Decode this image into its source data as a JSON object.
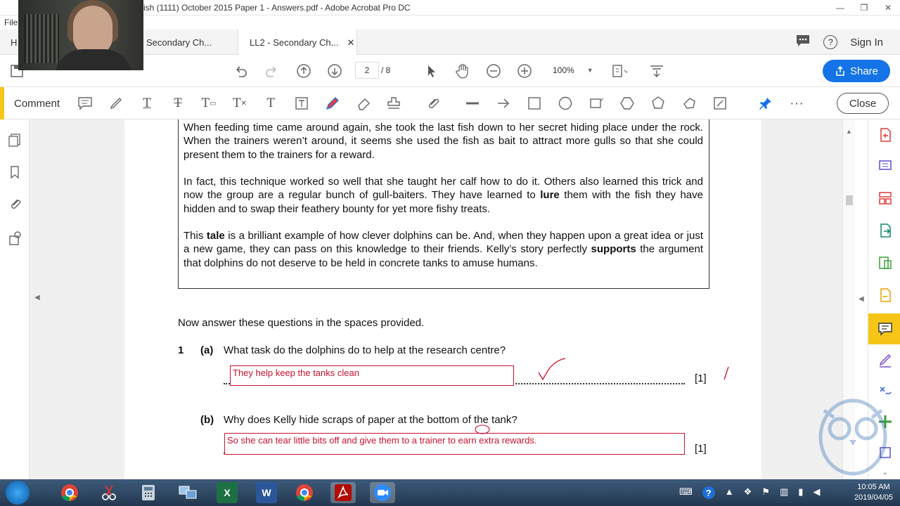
{
  "window": {
    "title": "ish (1111) October 2015 Paper 1 - Answers.pdf - Adobe Acrobat Pro DC",
    "controls": [
      "—",
      "❐",
      "✕"
    ]
  },
  "menubar": {
    "file": "File"
  },
  "tabs": {
    "home": "H",
    "tab1": "Secondary Ch...",
    "tab2": "LL2 - Secondary Ch...",
    "tab2_close": "✕",
    "sign_in": "Sign In",
    "help": "?"
  },
  "toolbar": {
    "page_current": "2",
    "page_total": "/ 8",
    "zoom": "100%",
    "share": "Share"
  },
  "commentbar": {
    "label": "Comment",
    "close": "Close"
  },
  "passage": {
    "p1": "When feeding time came around again, she took the last fish down to her secret hiding place under the rock. When the trainers weren’t around, it seems she used the fish as bait to attract more gulls so that she could present them to the trainers for a reward.",
    "p2_a": "In fact, this technique worked so well that she taught her calf how to do it. Others also learned this trick and now the group are a regular bunch of gull-baiters. They have learned to ",
    "p2_bold": "lure",
    "p2_b": " them with the fish they have hidden and to swap their feathery bounty for yet more fishy treats.",
    "p3_a": "This ",
    "p3_bold1": "tale",
    "p3_b": " is a brilliant example of how clever dolphins can be. And, when they happen upon a great idea or just a new game, they can pass on this knowledge to their friends. Kelly’s story perfectly ",
    "p3_bold2": "supports",
    "p3_c": " the argument that dolphins do not deserve to be held in concrete tanks to amuse humans."
  },
  "questions": {
    "instruction": "Now answer these questions in the spaces provided.",
    "q1_num": "1",
    "q1a_label": "(a)",
    "q1a_text": "What task do the dolphins do to help at the research centre?",
    "q1a_answer": "They help keep the tanks clean",
    "q1a_mark": "[1]",
    "q1b_label": "(b)",
    "q1b_text": "Why does Kelly hide scraps of paper at the bottom of the tank?",
    "q1b_answer": "So she can tear little bits off and give them to a trainer to earn extra rewards.",
    "q1b_mark": "[1]"
  },
  "taskbar": {
    "excel": "X",
    "word": "W",
    "clock_time": "10:05 AM",
    "clock_date": "2019/04/05"
  },
  "colors": {
    "accent": "#f5c518",
    "share_blue": "#1473e6",
    "answer_red": "#c8102e"
  }
}
